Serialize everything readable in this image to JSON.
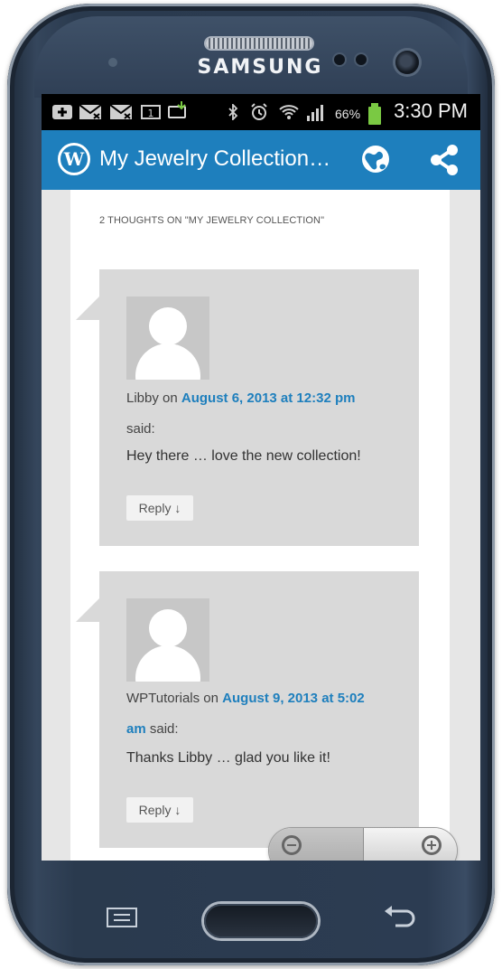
{
  "device": {
    "brand": "SAMSUNG"
  },
  "status_bar": {
    "battery_percent": "66%",
    "time": "3:30 PM",
    "battery_color": "#7ac943"
  },
  "app_bar": {
    "title": "My Jewelry Collection…",
    "background": "#1e7fbd",
    "icons": [
      "wordpress-icon",
      "globe-icon",
      "share-icon"
    ]
  },
  "comments": {
    "heading": "2 THOUGHTS ON \"MY JEWELRY COLLECTION\"",
    "items": [
      {
        "author": "Libby",
        "on_word": "on",
        "date": "August 6, 2013 at 12:32 pm",
        "said": "said:",
        "text": "Hey there … love the new collection!",
        "reply": "Reply ↓"
      },
      {
        "author": "WPTutorials",
        "on_word": "on",
        "date_part1": "August 9, 2013 at 5:02",
        "date_part2": "am",
        "said": "said:",
        "text": "Thanks Libby … glad you like it!",
        "reply": "Reply ↓"
      }
    ]
  },
  "zoom_controls": {
    "out": "zoom-out-icon",
    "in": "zoom-in-icon"
  },
  "nav_keys": [
    "menu-key-icon",
    "home-key",
    "back-key-icon"
  ]
}
